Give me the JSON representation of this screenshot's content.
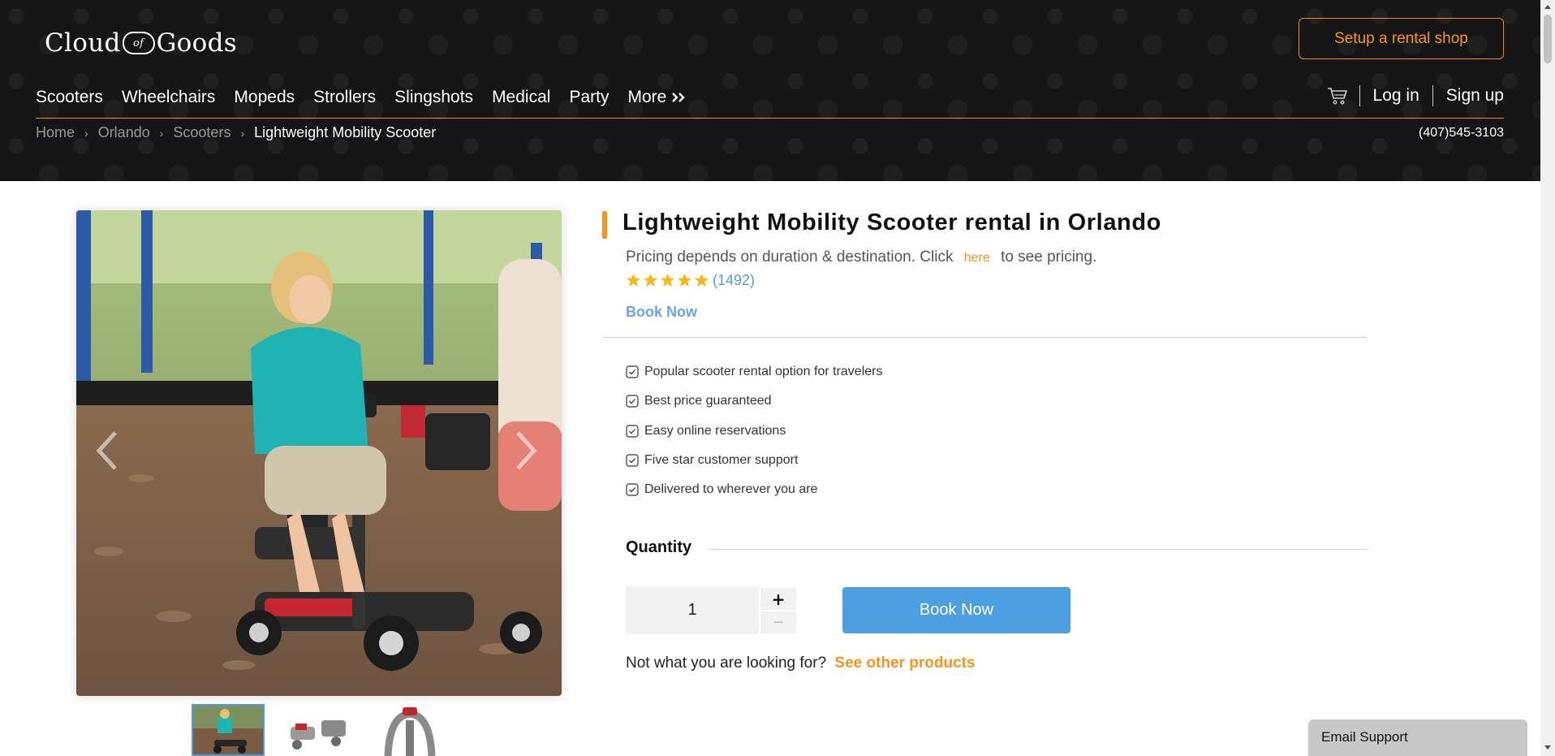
{
  "header": {
    "logo_left": "Cloud",
    "logo_middle": "of",
    "logo_right": "Goods",
    "setup_button": "Setup a rental shop",
    "nav": [
      "Scooters",
      "Wheelchairs",
      "Mopeds",
      "Strollers",
      "Slingshots",
      "Medical",
      "Party"
    ],
    "nav_more": "More",
    "login": "Log in",
    "signup": "Sign up",
    "phone": "(407)545-3103",
    "accent_color": "#f7941d"
  },
  "breadcrumb": [
    "Home",
    "Orlando",
    "Scooters",
    "Lightweight Mobility Scooter"
  ],
  "product": {
    "title": "Lightweight Mobility Scooter rental in Orlando",
    "pricing_before": "Pricing depends on duration & destination. Click",
    "pricing_link": "here",
    "pricing_after": "to see pricing.",
    "rating_stars": 5,
    "review_count": "(1492)",
    "book_now_link": "Book Now",
    "features": [
      "Popular scooter rental option for travelers",
      "Best price guaranteed",
      "Easy online reservations",
      "Five star customer support",
      "Delivered to wherever you are"
    ],
    "quantity_label": "Quantity",
    "quantity_value": "1",
    "plus": "+",
    "minus": "−",
    "book_button": "Book Now",
    "not_looking": "Not what you are looking for?",
    "see_other": "See other products",
    "button_color": "#4c9fe0"
  },
  "gallery": {
    "thumbnails": [
      "scooter-rider-photo",
      "scooter-folded-photo",
      "scooter-tiller-photo"
    ]
  },
  "support": {
    "label": "Email Support"
  }
}
